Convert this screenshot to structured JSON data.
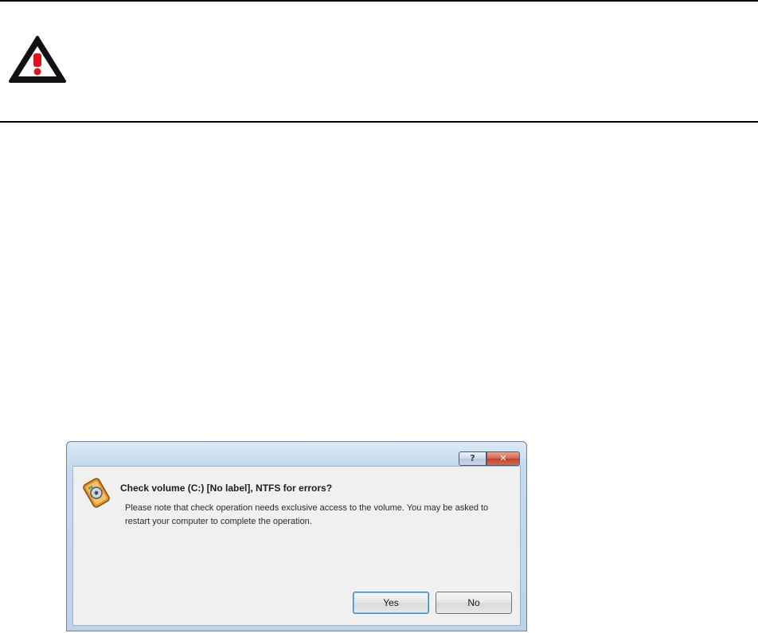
{
  "page": {
    "warning_icon": "warning-triangle-icon"
  },
  "dialog": {
    "help_label": "?",
    "close_label": "✕",
    "icon": "check-volume-icon",
    "title": "Check volume (C:) [No label], NTFS for errors?",
    "message": "Please note that check operation needs exclusive access to the volume. You may be asked to restart your computer to complete the operation.",
    "buttons": {
      "yes": "Yes",
      "no": "No"
    }
  },
  "colors": {
    "warning_red": "#e0141c",
    "close_red": "#c1412a",
    "default_button_border": "#3c7fb1"
  }
}
